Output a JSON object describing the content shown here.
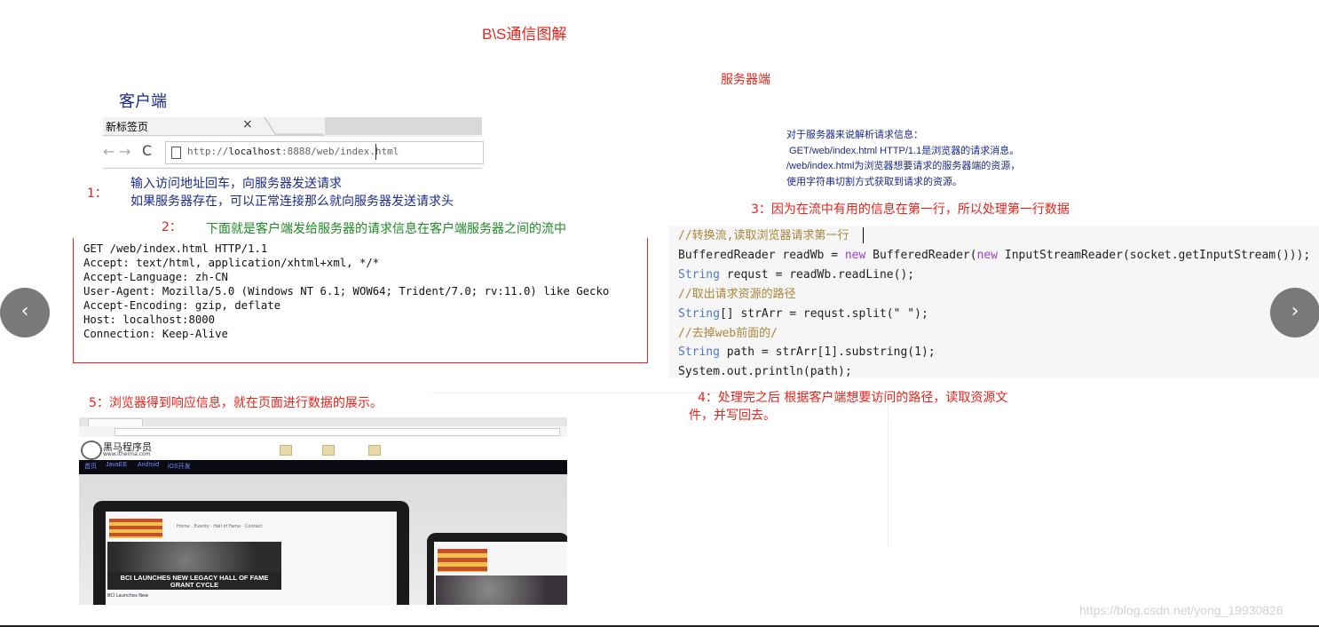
{
  "title": "B\\S通信图解",
  "client_label": "客户端",
  "server_label": "服务器端",
  "browser": {
    "tab_title": "新标签页",
    "tab_close": "×",
    "nav_back": "←",
    "nav_forward": "→",
    "reload": "C",
    "url_prefix": "http://",
    "url_host": "localhost",
    "url_rest": ":8888/web/index.html"
  },
  "step1": {
    "number": "1：",
    "line1": "输入访问地址回车，向服务器发送请求",
    "line2": "如果服务器存在，可以正常连接那么就向服务器发送请求头"
  },
  "step2": {
    "number": "2：",
    "text": "下面就是客户端发给服务器的请求信息在客户端服务器之间的流中"
  },
  "request_lines": [
    "GET /web/index.html HTTP/1.1",
    "Accept: text/html, application/xhtml+xml, */*",
    "Accept-Language: zh-CN",
    "User-Agent: Mozilla/5.0 (Windows NT 6.1; WOW64; Trident/7.0; rv:11.0) like Gecko",
    "Accept-Encoding: gzip, deflate",
    "Host: localhost:8000",
    "Connection: Keep-Alive"
  ],
  "server_info": [
    "对于服务器来说解析请求信息：",
    " GET/web/index.html HTTP/1.1是浏览器的请求消息。",
    "/web/index.html为浏览器想要请求的服务器端的资源，",
    "使用字符串切割方式获取到请求的资源。"
  ],
  "step3": "3：因为在流中有用的信息在第一行，所以处理第一行数据",
  "code": {
    "comment1": "//转换流,读取浏览器请求第一行",
    "l2_type": "BufferedReader",
    "l2_a": " readWb = ",
    "l2_new1": "new",
    "l2_b": " BufferedReader(",
    "l2_new2": "new",
    "l2_c": " InputStreamReader(socket.getInputStream()));",
    "l3_type": "String",
    "l3_rest": " requst = readWb.readLine();",
    "comment2": "//取出请求资源的路径",
    "l5_type": "String",
    "l5_rest": "[] strArr = requst.split(\" \");",
    "comment3": "//去掉web前面的/",
    "l7_type": "String",
    "l7_rest": " path = strArr[1].substring(1);",
    "l8": "System.out.println(path);"
  },
  "step4": {
    "line1": "4：处理完之后 根据客户端想要访问的路径，读取资源文",
    "line2": "件，并写回去。"
  },
  "step5": "5：浏览器得到响应信息，就在页面进行数据的展示。",
  "website": {
    "logo_text": "黑马程序员",
    "logo_sub": "www.itheima.com",
    "nav_links": [
      "首页",
      "JavaEE",
      "Android",
      "iOS开发"
    ],
    "laptop_nav": "Home · Events · Hall of Fame · Contact",
    "hero_text": "BCI LAUNCHES NEW LEGACY HALL OF FAME GRANT CYCLE",
    "hero_foot": "BCI Launches New"
  },
  "nav_arrows": {
    "prev": "‹",
    "next": "›"
  },
  "watermark": "https://blog.csdn.net/yong_19930826",
  "colors": {
    "red": "#e8231b",
    "navy": "#1b2a8c",
    "green": "#1e8a22",
    "code_comment": "#a8863a",
    "code_keyword": "#9b3dd3",
    "code_type": "#4d78c4"
  }
}
